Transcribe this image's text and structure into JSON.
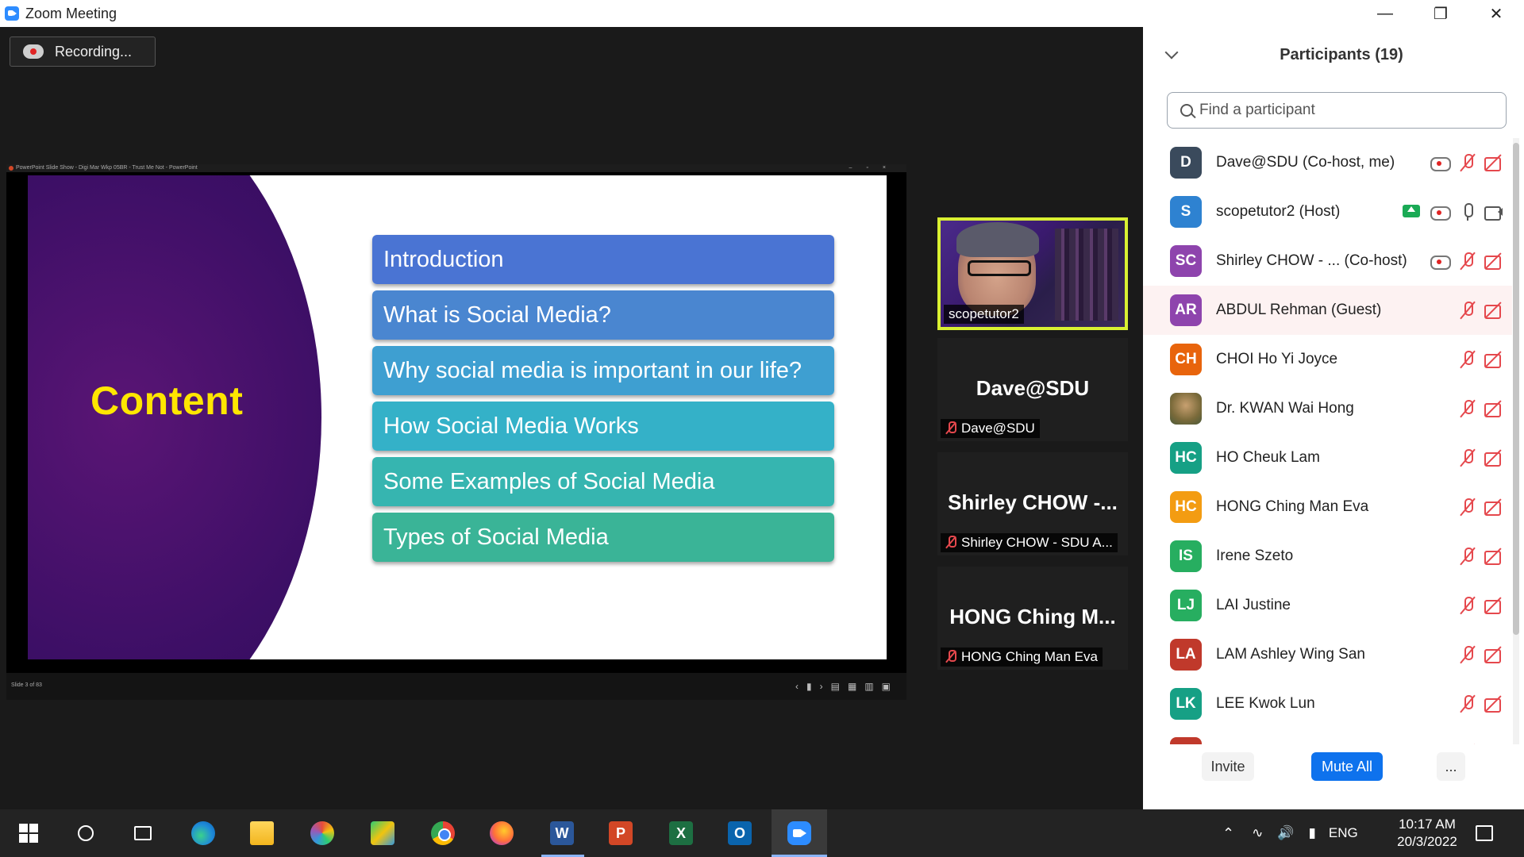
{
  "window": {
    "title": "Zoom Meeting"
  },
  "recording": {
    "label": "Recording..."
  },
  "ppt": {
    "title_bar": "PowerPoint Slide Show - Digi Mar Wkp 05BR - Trust Me Not - PowerPoint",
    "slide_number": "Slide 3 of 83"
  },
  "slide": {
    "title": "Content",
    "items": [
      {
        "label": "Introduction",
        "color": "#4a74d3"
      },
      {
        "label": "What is Social Media?",
        "color": "#4a86d0"
      },
      {
        "label": "Why social media is important in our life?",
        "color": "#3e9fd1"
      },
      {
        "label": "How Social Media Works",
        "color": "#34b1c8"
      },
      {
        "label": "Some Examples of Social Media",
        "color": "#36b5b0"
      },
      {
        "label": "Types of Social Media",
        "color": "#3ab497"
      }
    ]
  },
  "tiles": {
    "video": {
      "label": "scopetutor2"
    },
    "dave": {
      "name": "Dave@SDU",
      "label": "Dave@SDU"
    },
    "shirley": {
      "name": "Shirley CHOW -...",
      "label": "Shirley CHOW - SDU A..."
    },
    "hong": {
      "name": "HONG Ching M...",
      "label": "HONG Ching Man Eva"
    }
  },
  "panel": {
    "title": "Participants (19)",
    "search_placeholder": "Find a participant",
    "participants": [
      {
        "initials": "D",
        "name": "Dave@SDU (Co-host, me)",
        "color": "#3a4a5c"
      },
      {
        "initials": "S",
        "name": "scopetutor2 (Host)",
        "color": "#2e82d1"
      },
      {
        "initials": "SC",
        "name": "Shirley CHOW - ...  (Co-host)",
        "color": "#8e44ad"
      },
      {
        "initials": "AR",
        "name": "ABDUL Rehman (Guest)",
        "color": "#8e44ad"
      },
      {
        "initials": "CH",
        "name": "CHOI Ho Yi Joyce",
        "color": "#e8640c"
      },
      {
        "initials": "",
        "name": "Dr. KWAN Wai Hong",
        "color": "#7a6a3a"
      },
      {
        "initials": "HC",
        "name": "HO Cheuk Lam",
        "color": "#16a085"
      },
      {
        "initials": "HC",
        "name": "HONG Ching Man Eva",
        "color": "#f39c12"
      },
      {
        "initials": "IS",
        "name": "Irene Szeto",
        "color": "#27ae60"
      },
      {
        "initials": "LJ",
        "name": "LAI Justine",
        "color": "#27ae60"
      },
      {
        "initials": "LA",
        "name": "LAM Ashley Wing San",
        "color": "#c0392b"
      },
      {
        "initials": "LK",
        "name": "LEE Kwok Lun",
        "color": "#16a085"
      },
      {
        "initials": "",
        "name": "",
        "color": "#c0392b"
      }
    ],
    "invite_label": "Invite",
    "mute_all_label": "Mute All",
    "more_label": "..."
  },
  "taskbar": {
    "word_letter": "W",
    "ppt_letter": "P",
    "excel_letter": "X",
    "outlook_letter": "O",
    "language": "ENG",
    "time": "10:17 AM",
    "date": "20/3/2022"
  }
}
